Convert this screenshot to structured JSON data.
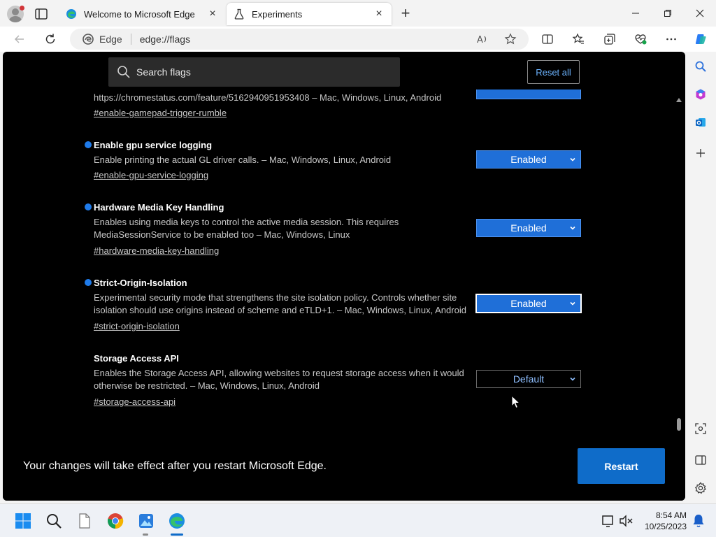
{
  "browser": {
    "tabs": [
      {
        "title": "Welcome to Microsoft Edge",
        "active": false
      },
      {
        "title": "Experiments",
        "active": true
      }
    ],
    "address_label": "Edge",
    "address_url": "edge://flags"
  },
  "flags_page": {
    "search_placeholder": "Search flags",
    "reset_all_label": "Reset all",
    "partial_top": {
      "desc": "https://chromestatus.com/feature/5162940951953408 – Mac, Windows, Linux, Android",
      "link": "#enable-gamepad-trigger-rumble"
    },
    "flags": [
      {
        "title": "Enable gpu service logging",
        "desc": "Enable printing the actual GL driver calls. – Mac, Windows, Linux, Android",
        "link": "#enable-gpu-service-logging",
        "value": "Enabled",
        "modified": true
      },
      {
        "title": "Hardware Media Key Handling",
        "desc": "Enables using media keys to control the active media session. This requires MediaSessionService to be enabled too – Mac, Windows, Linux",
        "link": "#hardware-media-key-handling",
        "value": "Enabled",
        "modified": true
      },
      {
        "title": "Strict-Origin-Isolation",
        "desc": "Experimental security mode that strengthens the site isolation policy. Controls whether site isolation should use origins instead of scheme and eTLD+1. – Mac, Windows, Linux, Android",
        "link": "#strict-origin-isolation",
        "value": "Enabled",
        "modified": true
      },
      {
        "title": "Storage Access API",
        "desc": "Enables the Storage Access API, allowing websites to request storage access when it would otherwise be restricted. – Mac, Windows, Linux, Android",
        "link": "#storage-access-api",
        "value": "Default",
        "modified": false
      }
    ],
    "restart_message": "Your changes will take effect after you restart Microsoft Edge.",
    "restart_label": "Restart"
  },
  "taskbar": {
    "time": "8:54 AM",
    "date": "10/25/2023"
  },
  "colors": {
    "accent": "#1f6fd8",
    "restart": "#0f6cc9",
    "modified_dot": "#1f7bea",
    "link_blue": "#6cb4ff"
  }
}
